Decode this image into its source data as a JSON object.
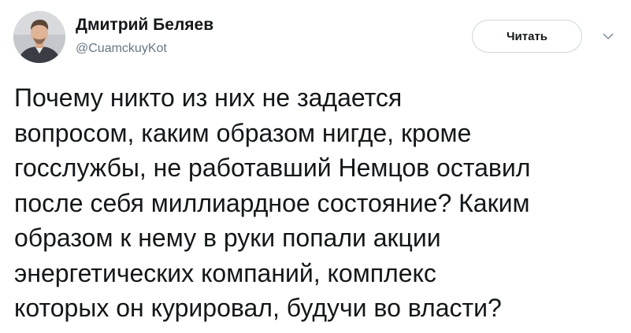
{
  "author": {
    "name": "Дмитрий Беляев",
    "handle": "@CuamckuyKot"
  },
  "actions": {
    "follow_label": "Читать",
    "menu_icon": "chevron-down-icon"
  },
  "tweet": {
    "lines": [
      "Почему никто из них не задается",
      "вопросом, каким образом нигде, кроме",
      "госслужбы, не работавший Немцов оставил",
      "после себя миллиардное состояние? Каким",
      "образом к нему в руки попали акции",
      "энергетических компаний, комплекс",
      "которых он курировал, будучи во власти?"
    ]
  },
  "colors": {
    "text": "#14171a",
    "secondary": "#657786",
    "border": "#cfd6dc"
  }
}
